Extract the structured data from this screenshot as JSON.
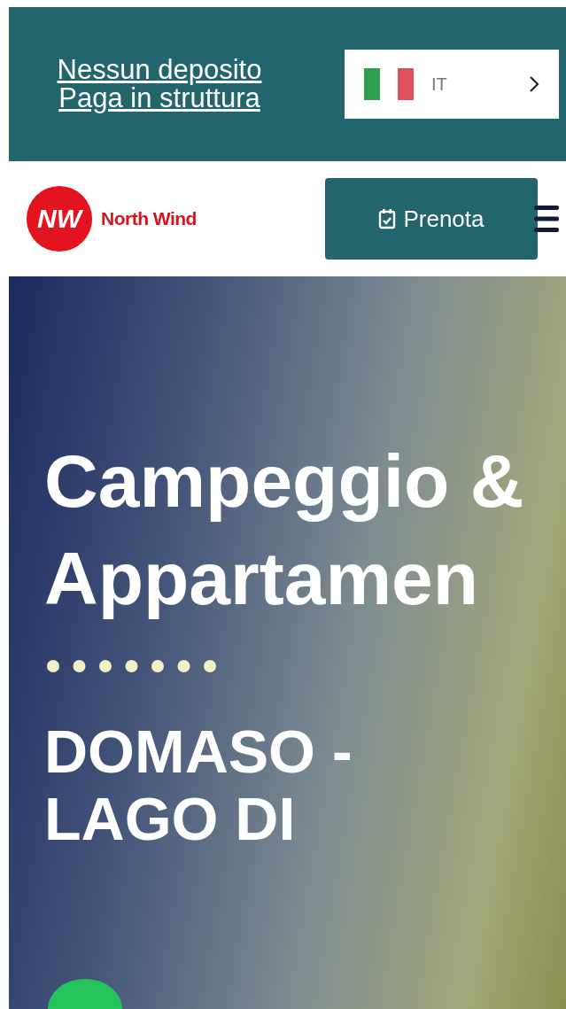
{
  "top_bar": {
    "notice_link": "Nessun deposito Paga in struttura",
    "language": {
      "code": "IT"
    }
  },
  "header": {
    "logo_initials": "NW",
    "logo_text": "North Wind",
    "book_button": "Prenota"
  },
  "hero": {
    "title": "Campeggio & Appartamen",
    "subtitle": "DOMASO - LAGO DI"
  }
}
